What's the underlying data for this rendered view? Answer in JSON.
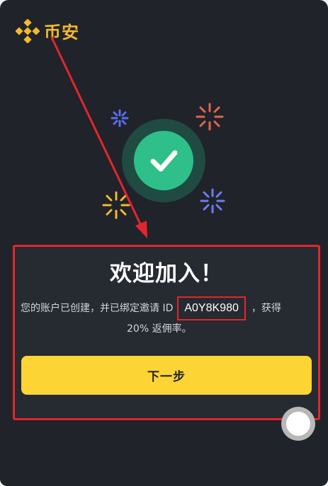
{
  "brand": {
    "name": "币安",
    "logo_icon": "binance-diamond-logo-icon",
    "color": "#f3ba2f"
  },
  "success": {
    "icon": "checkmark-icon",
    "color": "#2fbf8a"
  },
  "welcome": {
    "title": "欢迎加入！",
    "message_prefix": "您的账户已创建，并已绑定邀请 ID",
    "invite_id": "A0Y8K980",
    "message_suffix": "，获得",
    "message_line2": "20% 返佣率。"
  },
  "actions": {
    "next_label": "下一步",
    "floating_icon": "floating-assistant-icon"
  },
  "colors": {
    "background": "#20232a",
    "card_background": "#262a31",
    "highlight_red": "#e4252d",
    "button_yellow": "#fcd535"
  }
}
